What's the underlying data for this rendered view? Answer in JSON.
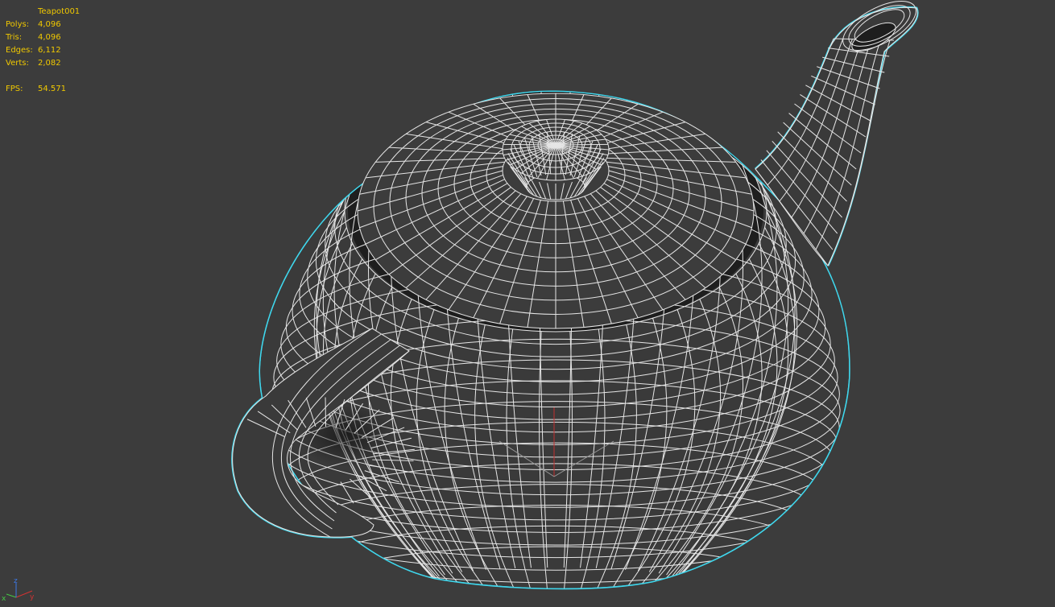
{
  "viewport": {
    "object_name": "Teapot001",
    "stats": [
      {
        "label": "Polys:",
        "value": "4,096"
      },
      {
        "label": "Tris:",
        "value": "4,096"
      },
      {
        "label": "Edges:",
        "value": "6,112"
      },
      {
        "label": "Verts:",
        "value": "2,082"
      }
    ],
    "fps": {
      "label": "FPS:",
      "value": "54.571"
    },
    "axis_tripod": {
      "x": "x",
      "y": "y",
      "z": "z"
    }
  },
  "colors": {
    "background": "#3c3c3c",
    "wire": "#e6e6e6",
    "selection": "#3fd8ee",
    "stats_text": "#f0c800",
    "axis_x": "#d23232",
    "axis_y": "#46c846",
    "axis_z": "#3c78e6"
  }
}
